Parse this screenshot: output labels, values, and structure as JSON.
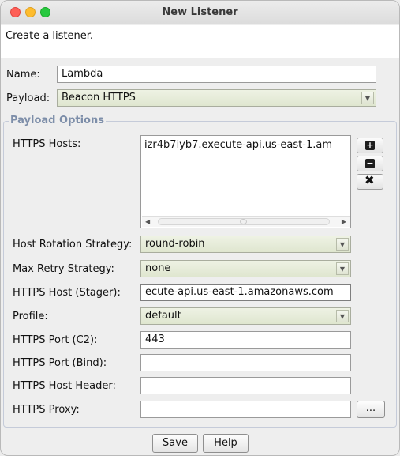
{
  "window": {
    "title": "New Listener"
  },
  "description": "Create a listener.",
  "name": {
    "label": "Name:",
    "value": "Lambda"
  },
  "payload": {
    "label": "Payload:",
    "value": "Beacon HTTPS"
  },
  "options": {
    "legend": "Payload Options",
    "https_hosts": {
      "label": "HTTPS Hosts:",
      "items": [
        "izr4b7iyb7.execute-api.us-east-1.am"
      ]
    },
    "host_rotation": {
      "label": "Host Rotation Strategy:",
      "value": "round-robin"
    },
    "max_retry": {
      "label": "Max Retry Strategy:",
      "value": "none"
    },
    "stager_host": {
      "label": "HTTPS Host (Stager):",
      "value": "ecute-api.us-east-1.amazonaws.com"
    },
    "profile": {
      "label": "Profile:",
      "value": "default"
    },
    "port_c2": {
      "label": "HTTPS Port (C2):",
      "value": "443"
    },
    "port_bind": {
      "label": "HTTPS Port (Bind):",
      "value": ""
    },
    "host_header": {
      "label": "HTTPS Host Header:",
      "value": ""
    },
    "proxy": {
      "label": "HTTPS Proxy:",
      "value": "",
      "browse_label": "..."
    }
  },
  "host_buttons": {
    "add_icon": "plus-icon",
    "remove_icon": "minus-icon",
    "clear_icon": "x-icon"
  },
  "footer": {
    "save_label": "Save",
    "help_label": "Help"
  }
}
